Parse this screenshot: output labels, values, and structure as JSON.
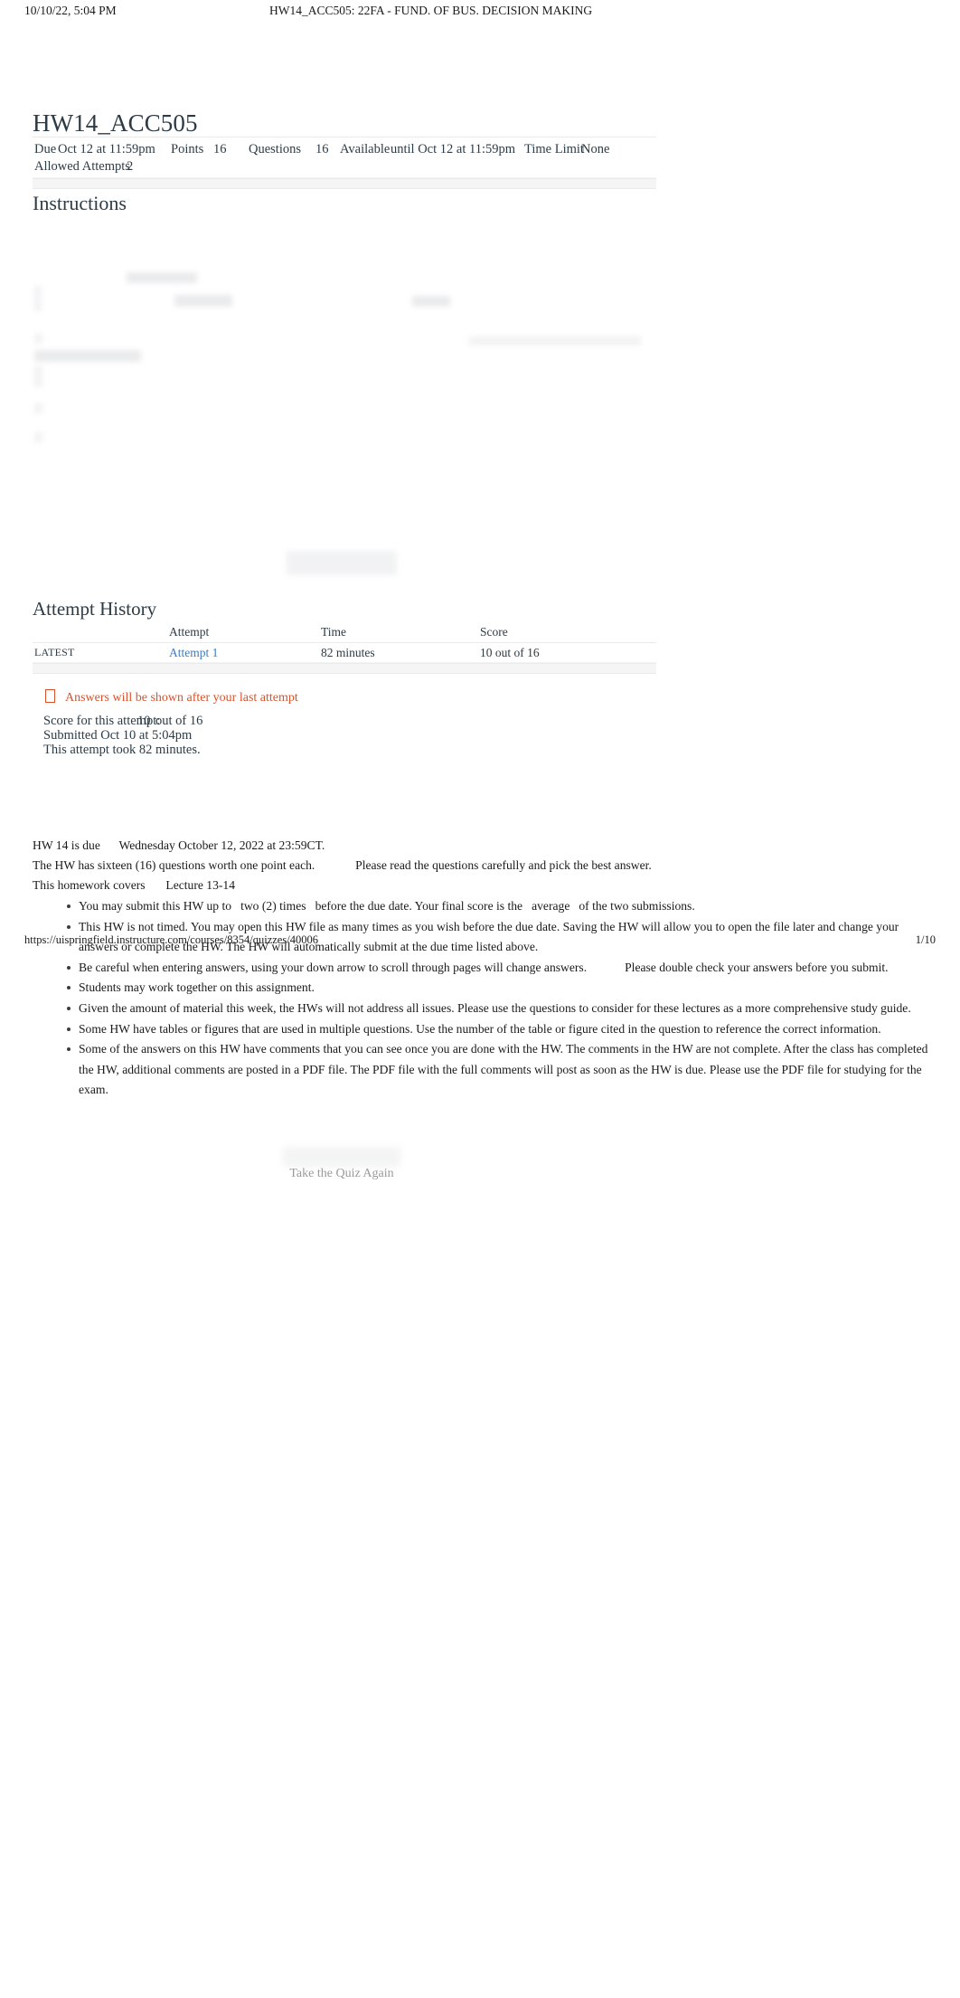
{
  "print_header": {
    "date": "10/10/22, 5:04 PM",
    "title": "HW14_ACC505: 22FA - FUND. OF BUS. DECISION MAKING"
  },
  "quiz": {
    "title": "HW14_ACC505",
    "meta": {
      "due_label": "Due",
      "due_value": "Oct 12 at 11:59pm",
      "points_label": "Points",
      "points_value": "16",
      "questions_label": "Questions",
      "questions_value": "16",
      "available_label": "Available",
      "available_value": "until Oct 12 at 11:59pm",
      "time_limit_label": "Time Limit",
      "time_limit_value": "None",
      "allowed_attempts_label": "Allowed Attempts",
      "allowed_attempts_value": "2"
    }
  },
  "instructions": {
    "heading": "Instructions"
  },
  "attempt_history": {
    "heading": "Attempt History",
    "columns": [
      "",
      "Attempt",
      "Time",
      "Score"
    ],
    "rows": [
      {
        "kept": "LATEST",
        "attempt": "Attempt 1",
        "time": "82 minutes",
        "score": "10 out of 16"
      }
    ]
  },
  "notice": {
    "icon": "warning-icon",
    "text": "Answers will be shown after your last attempt"
  },
  "score_details": {
    "score_label": "Score for this attempt:",
    "score_value": "10",
    "score_out_of": "out of 16",
    "submitted": "Submitted Oct 10 at 5:04pm",
    "duration": "This attempt took 82 minutes."
  },
  "body": {
    "due_line_label": "HW 14 is due",
    "due_line_value": "Wednesday October 12, 2022 at 23:59CT.",
    "questions_line_a": "The HW has sixteen (16) questions worth one point each.",
    "questions_line_b": "Please read the questions carefully and pick the best answer.",
    "covers_label": "This homework covers",
    "covers_value": "Lecture 13-14",
    "bullets": [
      {
        "parts": [
          "You may submit this HW up to",
          "two (2) times",
          "before the due date. Your final score is the",
          "average",
          "of the two submissions."
        ]
      },
      {
        "parts": [
          "This HW is not timed. You may open this HW file as many times as you wish before the due date. Saving the HW will allow you to open the file later and change your answers or complete the HW. The HW will automatically submit at the due time listed above."
        ]
      },
      {
        "parts": [
          "Be careful when entering answers, using your down arrow to scroll through pages will change answers.",
          "Please double check your answers before you submit."
        ]
      },
      {
        "parts": [
          "Students may work together on this assignment."
        ]
      },
      {
        "parts": [
          "Given the amount of material this week, the HWs will not address all issues. Please use the questions to consider for these lectures as a more comprehensive study guide."
        ]
      },
      {
        "parts": [
          "Some HW have tables or figures that are used in multiple questions. Use the number of the table or figure cited in the question to reference the correct information."
        ]
      },
      {
        "parts": [
          "Some of the answers on this HW have comments that you can see once you are done with the HW. The comments in the HW are not complete. After the class has completed the HW, additional comments are posted in a PDF file. The PDF file with the full comments will post as soon as the HW is due. Please use the PDF file for studying for the exam."
        ]
      }
    ]
  },
  "actions": {
    "take_quiz_again": "Take the Quiz Again"
  },
  "print_footer": {
    "url": "https://uispringfield.instructure.com/courses/8354/quizzes/40006",
    "page": "1/10"
  },
  "colors": {
    "link": "#3b7cc4",
    "warning": "#d9522b",
    "text": "#2d3b45",
    "muted": "#9a9a9a"
  }
}
